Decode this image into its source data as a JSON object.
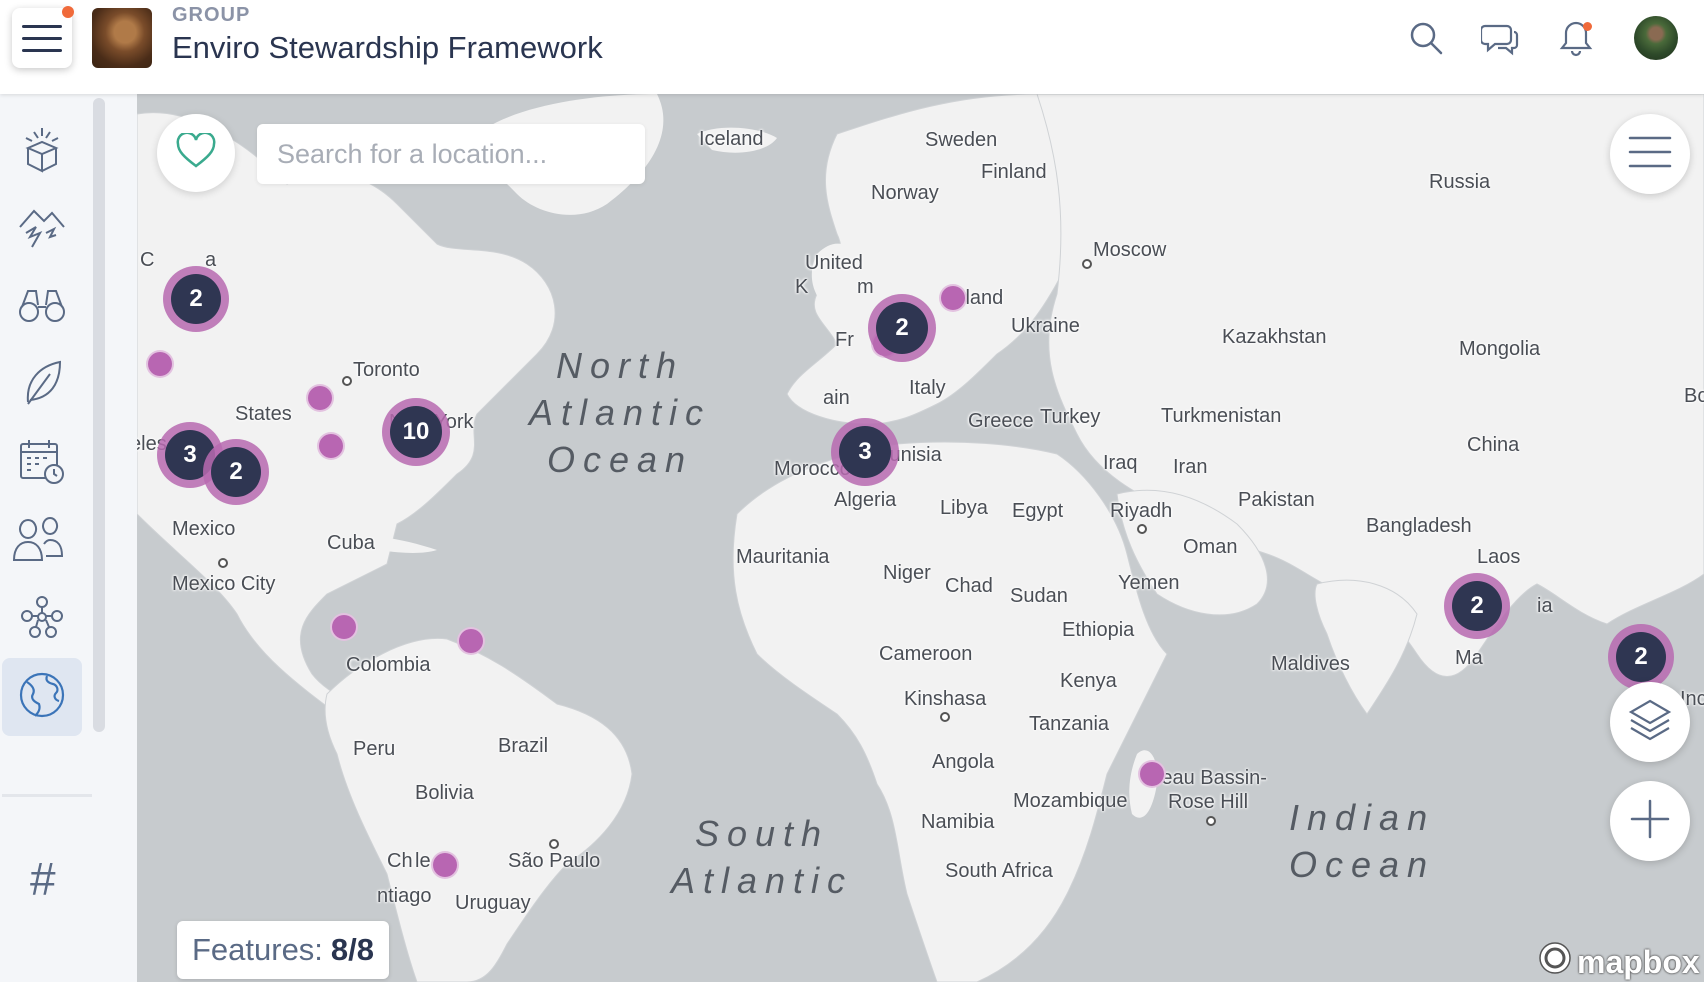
{
  "header": {
    "group_label": "GROUP",
    "group_title": "Enviro Stewardship Framework",
    "icons": [
      "hamburger-menu-icon",
      "search-icon",
      "messages-icon",
      "notifications-icon"
    ]
  },
  "sidebar": {
    "items": [
      {
        "icon": "explore-gifts-icon"
      },
      {
        "icon": "mountains-icon"
      },
      {
        "icon": "binoculars-icon"
      },
      {
        "icon": "leaf-icon"
      },
      {
        "icon": "calendar-icon"
      },
      {
        "icon": "members-icon"
      },
      {
        "icon": "groups-network-icon"
      },
      {
        "icon": "globe-map-icon",
        "active": true
      }
    ],
    "hash_label": "#"
  },
  "map": {
    "search_placeholder": "Search for a location...",
    "features_label": "Features:",
    "features_value": "8/8",
    "attribution": "mapbox",
    "oceans": {
      "north_atlantic": "North\nAtlantic\nOcean",
      "south_atlantic": "South\nAtlantic",
      "indian": "Indian\nOcean"
    },
    "places": [
      {
        "name": "Iceland"
      },
      {
        "name": "Sweden"
      },
      {
        "name": "Finland"
      },
      {
        "name": "Norway"
      },
      {
        "name": "Russia"
      },
      {
        "name": "Moscow"
      },
      {
        "name": "United"
      },
      {
        "name": "K"
      },
      {
        "name": "m"
      },
      {
        "name": "Poland"
      },
      {
        "name": "Ukraine"
      },
      {
        "name": "Kazakhstan"
      },
      {
        "name": "Mongolia"
      },
      {
        "name": "Fr"
      },
      {
        "name": "ce"
      },
      {
        "name": "Italy"
      },
      {
        "name": "ain"
      },
      {
        "name": "Greece"
      },
      {
        "name": "Turkey"
      },
      {
        "name": "Turkmenistan"
      },
      {
        "name": "China"
      },
      {
        "name": "Bc"
      },
      {
        "name": "Tunisia"
      },
      {
        "name": "Morocco"
      },
      {
        "name": "Iraq"
      },
      {
        "name": "Iran"
      },
      {
        "name": "Algeria"
      },
      {
        "name": "Libya"
      },
      {
        "name": "Egypt"
      },
      {
        "name": "Riyadh"
      },
      {
        "name": "Pakistan"
      },
      {
        "name": "Bangladesh"
      },
      {
        "name": "Oman"
      },
      {
        "name": "Laos"
      },
      {
        "name": "Mauritania"
      },
      {
        "name": "Niger"
      },
      {
        "name": "Chad"
      },
      {
        "name": "Sudan"
      },
      {
        "name": "Yemen"
      },
      {
        "name": "C"
      },
      {
        "name": "ia"
      },
      {
        "name": "Ethiopia"
      },
      {
        "name": "Cameroon"
      },
      {
        "name": "Maldives"
      },
      {
        "name": "Ma"
      },
      {
        "name": "Kinshasa"
      },
      {
        "name": "Kenya"
      },
      {
        "name": "Inc"
      },
      {
        "name": "Tanzania"
      },
      {
        "name": "Angola"
      },
      {
        "name": "Beau Bassin-"
      },
      {
        "name": "Rose Hill"
      },
      {
        "name": "Mozambique"
      },
      {
        "name": "Namibia"
      },
      {
        "name": "South Africa"
      },
      {
        "name": "C"
      },
      {
        "name": "a"
      },
      {
        "name": "Toronto"
      },
      {
        "name": "States"
      },
      {
        "name": "eles"
      },
      {
        "name": "New York"
      },
      {
        "name": "Mexico"
      },
      {
        "name": "Cuba"
      },
      {
        "name": "Mexico City"
      },
      {
        "name": "Colombia"
      },
      {
        "name": "Peru"
      },
      {
        "name": "Brazil"
      },
      {
        "name": "Bolivia"
      },
      {
        "name": "Ch"
      },
      {
        "name": "le"
      },
      {
        "name": "São Paulo"
      },
      {
        "name": "ntiago"
      },
      {
        "name": "Uruguay"
      }
    ],
    "clusters": [
      {
        "count": "2"
      },
      {
        "count": "3"
      },
      {
        "count": "2"
      },
      {
        "count": "10"
      },
      {
        "count": "2"
      },
      {
        "count": "3"
      },
      {
        "count": "2"
      },
      {
        "count": "2"
      }
    ],
    "pin_count": 9
  },
  "colors": {
    "water": "#c7cbce",
    "land": "#f2f2f2",
    "cluster_ring": "#b76ab0",
    "cluster_core": "#2f3652",
    "pin": "#b866b2",
    "accent_teal": "#3aaa8e",
    "nav_dark": "#2a3550"
  }
}
